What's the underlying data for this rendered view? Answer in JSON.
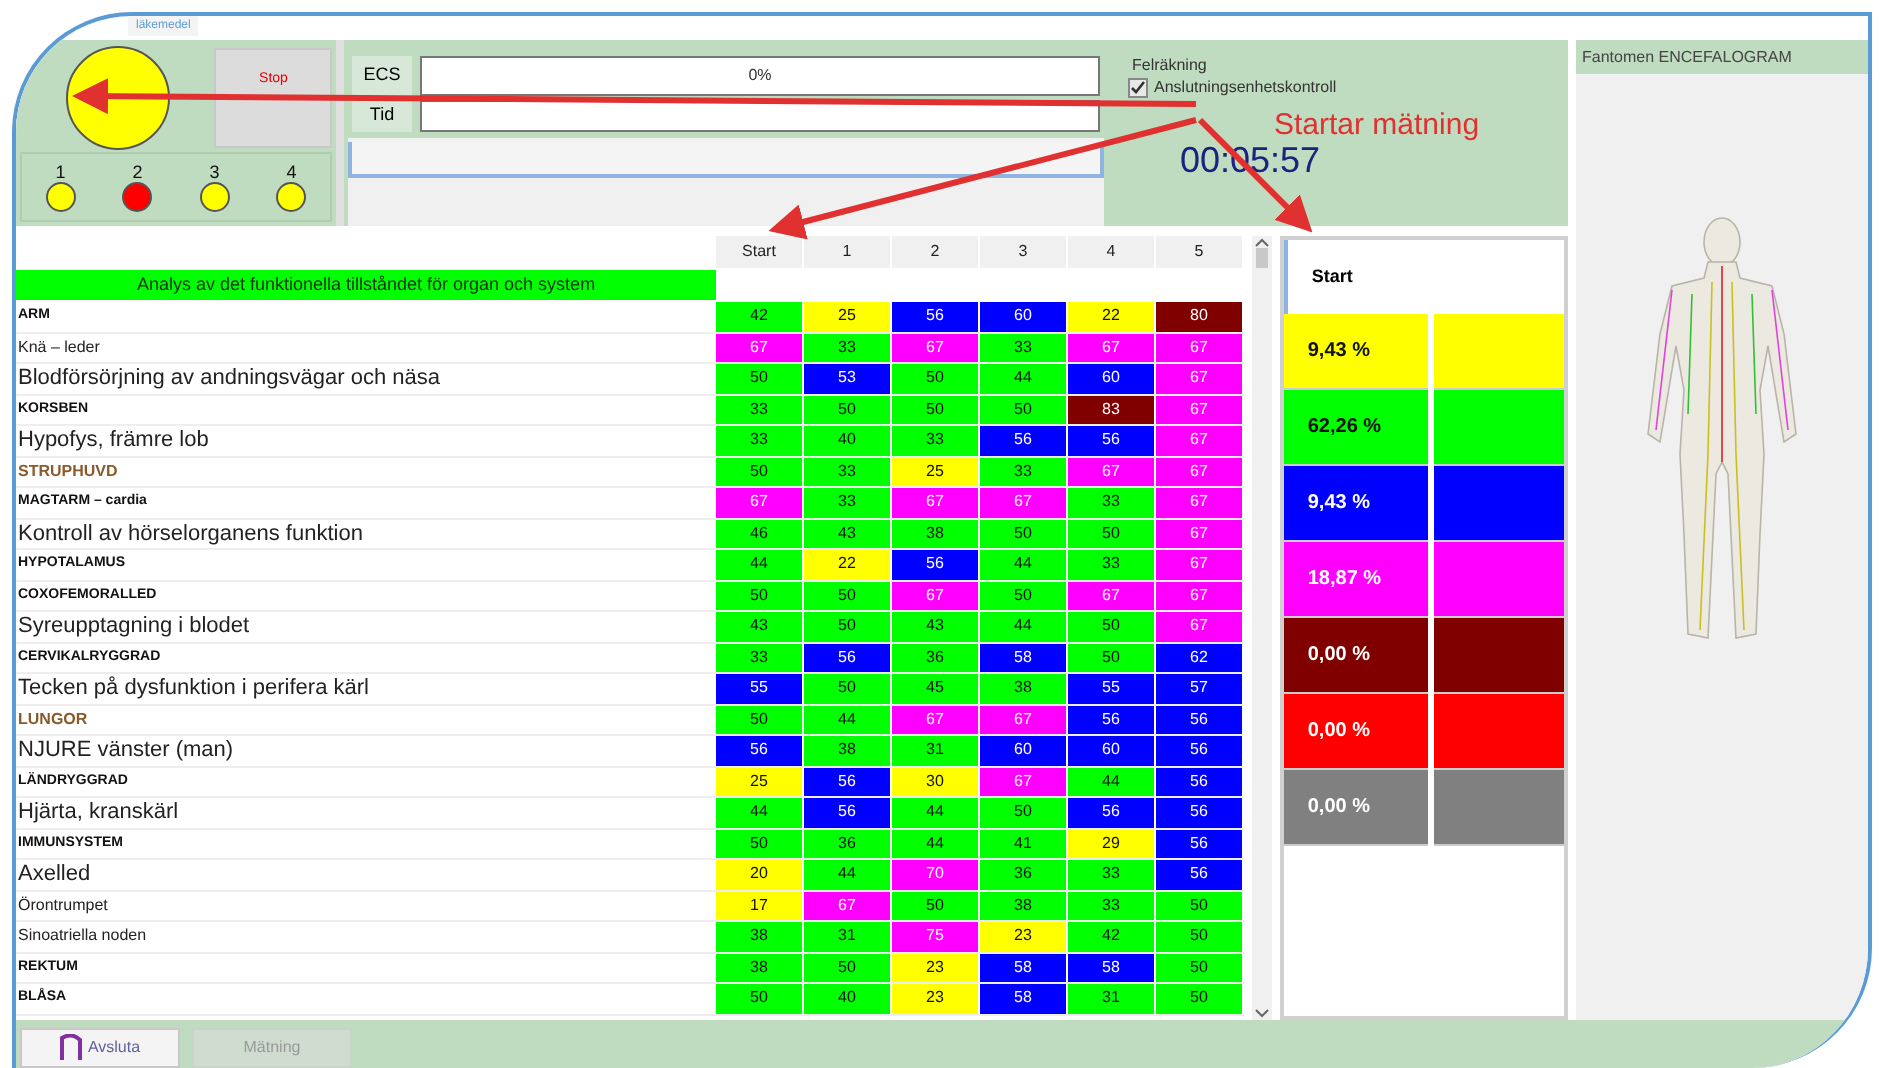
{
  "top_tab": {
    "label": "läkemedel"
  },
  "indicator": {
    "color": "#ffff00"
  },
  "stop_button": {
    "label": "Stop"
  },
  "channels": [
    {
      "label": "1",
      "color": "#ffff00"
    },
    {
      "label": "2",
      "color": "#ff0000"
    },
    {
      "label": "3",
      "color": "#ffff00"
    },
    {
      "label": "4",
      "color": "#ffff00"
    }
  ],
  "ecs": {
    "label": "ECS",
    "value": "0%",
    "level": 0
  },
  "time_field": {
    "label": "Tid"
  },
  "status": {
    "group_label": "Felräkning",
    "checkbox": {
      "label": "Anslutningsenhetskontroll",
      "checked": true
    },
    "timer": "00:05:57"
  },
  "annotation": {
    "text": "Startar mätning"
  },
  "table": {
    "title": "Analys av det funktionella tillståndet för organ och system",
    "columns": [
      "Start",
      "1",
      "2",
      "3",
      "4",
      "5"
    ],
    "rows": [
      {
        "label": "ARM",
        "kind": "caps",
        "cells": [
          {
            "value": "42",
            "color": "#00ff00"
          },
          {
            "value": "25",
            "color": "#ffff00"
          },
          {
            "value": "56",
            "color": "#0000ff"
          },
          {
            "value": "60",
            "color": "#0000ff"
          },
          {
            "value": "22",
            "color": "#ffff00"
          },
          {
            "value": "80",
            "color": "#800000"
          }
        ]
      },
      {
        "label": "Knä – leder",
        "kind": "small",
        "cells": [
          {
            "value": "67",
            "color": "#ff00ff"
          },
          {
            "value": "33",
            "color": "#00ff00"
          },
          {
            "value": "67",
            "color": "#ff00ff"
          },
          {
            "value": "33",
            "color": "#00ff00"
          },
          {
            "value": "67",
            "color": "#ff00ff"
          },
          {
            "value": "67",
            "color": "#ff00ff"
          }
        ]
      },
      {
        "label": "Blodförsörjning av andningsvägar och näsa",
        "kind": "large",
        "cells": [
          {
            "value": "50",
            "color": "#00ff00"
          },
          {
            "value": "53",
            "color": "#0000ff"
          },
          {
            "value": "50",
            "color": "#00ff00"
          },
          {
            "value": "44",
            "color": "#00ff00"
          },
          {
            "value": "60",
            "color": "#0000ff"
          },
          {
            "value": "67",
            "color": "#ff00ff"
          }
        ]
      },
      {
        "label": "KORSBEN",
        "kind": "caps",
        "cells": [
          {
            "value": "33",
            "color": "#00ff00"
          },
          {
            "value": "50",
            "color": "#00ff00"
          },
          {
            "value": "50",
            "color": "#00ff00"
          },
          {
            "value": "50",
            "color": "#00ff00"
          },
          {
            "value": "83",
            "color": "#800000"
          },
          {
            "value": "67",
            "color": "#ff00ff"
          }
        ]
      },
      {
        "label": "Hypofys, främre lob",
        "kind": "large",
        "cells": [
          {
            "value": "33",
            "color": "#00ff00"
          },
          {
            "value": "40",
            "color": "#00ff00"
          },
          {
            "value": "33",
            "color": "#00ff00"
          },
          {
            "value": "56",
            "color": "#0000ff"
          },
          {
            "value": "56",
            "color": "#0000ff"
          },
          {
            "value": "67",
            "color": "#ff00ff"
          }
        ]
      },
      {
        "label": "STRUPHUVD",
        "kind": "brown",
        "cells": [
          {
            "value": "50",
            "color": "#00ff00"
          },
          {
            "value": "33",
            "color": "#00ff00"
          },
          {
            "value": "25",
            "color": "#ffff00"
          },
          {
            "value": "33",
            "color": "#00ff00"
          },
          {
            "value": "67",
            "color": "#ff00ff"
          },
          {
            "value": "67",
            "color": "#ff00ff"
          }
        ]
      },
      {
        "label": "MAGTARM – cardia",
        "kind": "caps",
        "cells": [
          {
            "value": "67",
            "color": "#ff00ff"
          },
          {
            "value": "33",
            "color": "#00ff00"
          },
          {
            "value": "67",
            "color": "#ff00ff"
          },
          {
            "value": "67",
            "color": "#ff00ff"
          },
          {
            "value": "33",
            "color": "#00ff00"
          },
          {
            "value": "67",
            "color": "#ff00ff"
          }
        ]
      },
      {
        "label": "Kontroll av hörselorganens funktion",
        "kind": "large",
        "cells": [
          {
            "value": "46",
            "color": "#00ff00"
          },
          {
            "value": "43",
            "color": "#00ff00"
          },
          {
            "value": "38",
            "color": "#00ff00"
          },
          {
            "value": "50",
            "color": "#00ff00"
          },
          {
            "value": "50",
            "color": "#00ff00"
          },
          {
            "value": "67",
            "color": "#ff00ff"
          }
        ]
      },
      {
        "label": "HYPOTALAMUS",
        "kind": "caps",
        "cells": [
          {
            "value": "44",
            "color": "#00ff00"
          },
          {
            "value": "22",
            "color": "#ffff00"
          },
          {
            "value": "56",
            "color": "#0000ff"
          },
          {
            "value": "44",
            "color": "#00ff00"
          },
          {
            "value": "33",
            "color": "#00ff00"
          },
          {
            "value": "67",
            "color": "#ff00ff"
          }
        ]
      },
      {
        "label": "COXOFEMORALLED",
        "kind": "caps",
        "cells": [
          {
            "value": "50",
            "color": "#00ff00"
          },
          {
            "value": "50",
            "color": "#00ff00"
          },
          {
            "value": "67",
            "color": "#ff00ff"
          },
          {
            "value": "50",
            "color": "#00ff00"
          },
          {
            "value": "67",
            "color": "#ff00ff"
          },
          {
            "value": "67",
            "color": "#ff00ff"
          }
        ]
      },
      {
        "label": "Syreupptagning i blodet",
        "kind": "large",
        "cells": [
          {
            "value": "43",
            "color": "#00ff00"
          },
          {
            "value": "50",
            "color": "#00ff00"
          },
          {
            "value": "43",
            "color": "#00ff00"
          },
          {
            "value": "44",
            "color": "#00ff00"
          },
          {
            "value": "50",
            "color": "#00ff00"
          },
          {
            "value": "67",
            "color": "#ff00ff"
          }
        ]
      },
      {
        "label": "CERVIKALRYGGRAD",
        "kind": "caps",
        "cells": [
          {
            "value": "33",
            "color": "#00ff00"
          },
          {
            "value": "56",
            "color": "#0000ff"
          },
          {
            "value": "36",
            "color": "#00ff00"
          },
          {
            "value": "58",
            "color": "#0000ff"
          },
          {
            "value": "50",
            "color": "#00ff00"
          },
          {
            "value": "62",
            "color": "#0000ff"
          }
        ]
      },
      {
        "label": "Tecken på dysfunktion i perifera kärl",
        "kind": "large",
        "cells": [
          {
            "value": "55",
            "color": "#0000ff"
          },
          {
            "value": "50",
            "color": "#00ff00"
          },
          {
            "value": "45",
            "color": "#00ff00"
          },
          {
            "value": "38",
            "color": "#00ff00"
          },
          {
            "value": "55",
            "color": "#0000ff"
          },
          {
            "value": "57",
            "color": "#0000ff"
          }
        ]
      },
      {
        "label": "LUNGOR",
        "kind": "brown",
        "cells": [
          {
            "value": "50",
            "color": "#00ff00"
          },
          {
            "value": "44",
            "color": "#00ff00"
          },
          {
            "value": "67",
            "color": "#ff00ff"
          },
          {
            "value": "67",
            "color": "#ff00ff"
          },
          {
            "value": "56",
            "color": "#0000ff"
          },
          {
            "value": "56",
            "color": "#0000ff"
          }
        ]
      },
      {
        "label": "NJURE vänster (man)",
        "kind": "large",
        "cells": [
          {
            "value": "56",
            "color": "#0000ff"
          },
          {
            "value": "38",
            "color": "#00ff00"
          },
          {
            "value": "31",
            "color": "#00ff00"
          },
          {
            "value": "60",
            "color": "#0000ff"
          },
          {
            "value": "60",
            "color": "#0000ff"
          },
          {
            "value": "56",
            "color": "#0000ff"
          }
        ]
      },
      {
        "label": "LÄNDRYGGRAD",
        "kind": "caps",
        "cells": [
          {
            "value": "25",
            "color": "#ffff00"
          },
          {
            "value": "56",
            "color": "#0000ff"
          },
          {
            "value": "30",
            "color": "#ffff00"
          },
          {
            "value": "67",
            "color": "#ff00ff"
          },
          {
            "value": "44",
            "color": "#00ff00"
          },
          {
            "value": "56",
            "color": "#0000ff"
          }
        ]
      },
      {
        "label": "Hjärta, kranskärl",
        "kind": "large",
        "cells": [
          {
            "value": "44",
            "color": "#00ff00"
          },
          {
            "value": "56",
            "color": "#0000ff"
          },
          {
            "value": "44",
            "color": "#00ff00"
          },
          {
            "value": "50",
            "color": "#00ff00"
          },
          {
            "value": "56",
            "color": "#0000ff"
          },
          {
            "value": "56",
            "color": "#0000ff"
          }
        ]
      },
      {
        "label": "IMMUNSYSTEM",
        "kind": "caps",
        "cells": [
          {
            "value": "50",
            "color": "#00ff00"
          },
          {
            "value": "36",
            "color": "#00ff00"
          },
          {
            "value": "44",
            "color": "#00ff00"
          },
          {
            "value": "41",
            "color": "#00ff00"
          },
          {
            "value": "29",
            "color": "#ffff00"
          },
          {
            "value": "56",
            "color": "#0000ff"
          }
        ]
      },
      {
        "label": "Axelled",
        "kind": "large",
        "cells": [
          {
            "value": "20",
            "color": "#ffff00"
          },
          {
            "value": "44",
            "color": "#00ff00"
          },
          {
            "value": "70",
            "color": "#ff00ff"
          },
          {
            "value": "36",
            "color": "#00ff00"
          },
          {
            "value": "33",
            "color": "#00ff00"
          },
          {
            "value": "56",
            "color": "#0000ff"
          }
        ]
      },
      {
        "label": "Örontrumpet",
        "kind": "small",
        "cells": [
          {
            "value": "17",
            "color": "#ffff00"
          },
          {
            "value": "67",
            "color": "#ff00ff"
          },
          {
            "value": "50",
            "color": "#00ff00"
          },
          {
            "value": "38",
            "color": "#00ff00"
          },
          {
            "value": "33",
            "color": "#00ff00"
          },
          {
            "value": "50",
            "color": "#00ff00"
          }
        ]
      },
      {
        "label": "Sinoatriella noden",
        "kind": "small",
        "cells": [
          {
            "value": "38",
            "color": "#00ff00"
          },
          {
            "value": "31",
            "color": "#00ff00"
          },
          {
            "value": "75",
            "color": "#ff00ff"
          },
          {
            "value": "23",
            "color": "#ffff00"
          },
          {
            "value": "42",
            "color": "#00ff00"
          },
          {
            "value": "50",
            "color": "#00ff00"
          }
        ]
      },
      {
        "label": "REKTUM",
        "kind": "caps",
        "cells": [
          {
            "value": "38",
            "color": "#00ff00"
          },
          {
            "value": "50",
            "color": "#00ff00"
          },
          {
            "value": "23",
            "color": "#ffff00"
          },
          {
            "value": "58",
            "color": "#0000ff"
          },
          {
            "value": "58",
            "color": "#0000ff"
          },
          {
            "value": "50",
            "color": "#00ff00"
          }
        ]
      },
      {
        "label": "BLÅSA",
        "kind": "caps",
        "cells": [
          {
            "value": "50",
            "color": "#00ff00"
          },
          {
            "value": "40",
            "color": "#00ff00"
          },
          {
            "value": "23",
            "color": "#ffff00"
          },
          {
            "value": "58",
            "color": "#0000ff"
          },
          {
            "value": "31",
            "color": "#00ff00"
          },
          {
            "value": "50",
            "color": "#00ff00"
          }
        ]
      }
    ]
  },
  "summary": {
    "header": "Start",
    "rows": [
      {
        "value": "9,43 %",
        "color": "#ffff00"
      },
      {
        "value": "62,26 %",
        "color": "#00ff00"
      },
      {
        "value": "9,43 %",
        "color": "#0000ff"
      },
      {
        "value": "18,87 %",
        "color": "#ff00ff"
      },
      {
        "value": "0,00 %",
        "color": "#800000"
      },
      {
        "value": "0,00 %",
        "color": "#ff0000"
      },
      {
        "value": "0,00 %",
        "color": "#808080"
      }
    ]
  },
  "figure_panel": {
    "title": "Fantomen ENCEFALOGRAM"
  },
  "bottom_buttons": [
    {
      "label": "Avsluta",
      "disabled": false
    },
    {
      "label": "Mätning",
      "disabled": true
    }
  ]
}
